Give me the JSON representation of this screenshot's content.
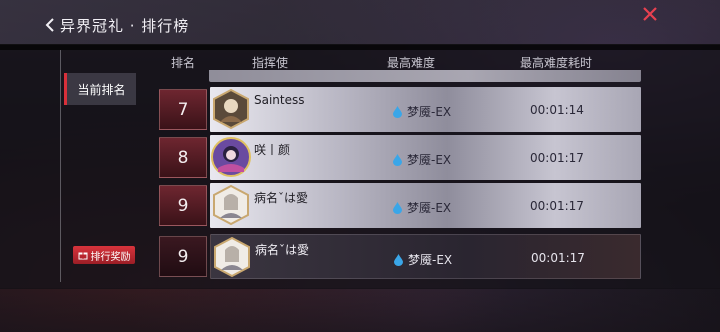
{
  "header": {
    "title": "异界冠礼 · 排行榜"
  },
  "sidebar": {
    "current_rank_tab": "当前排名",
    "reward_button": "排行奖励"
  },
  "table": {
    "columns": [
      "排名",
      "指挥使",
      "最高难度",
      "最高难度耗时"
    ],
    "rows": [
      {
        "rank": "7",
        "name": "Saintess",
        "difficulty": "梦魇-EX",
        "time": "00:01:14"
      },
      {
        "rank": "8",
        "name": "咲丨颜",
        "difficulty": "梦魇-EX",
        "time": "00:01:17"
      },
      {
        "rank": "9",
        "name": "病名ˇは愛",
        "difficulty": "梦魇-EX",
        "time": "00:01:17"
      }
    ],
    "self_row": {
      "rank": "9",
      "name": "病名ˇは愛",
      "difficulty": "梦魇-EX",
      "time": "00:01:17"
    }
  },
  "colors": {
    "accent_red": "#d8303a",
    "rank_bg": "#6e2630",
    "drop_blue": "#3aa6e8"
  }
}
